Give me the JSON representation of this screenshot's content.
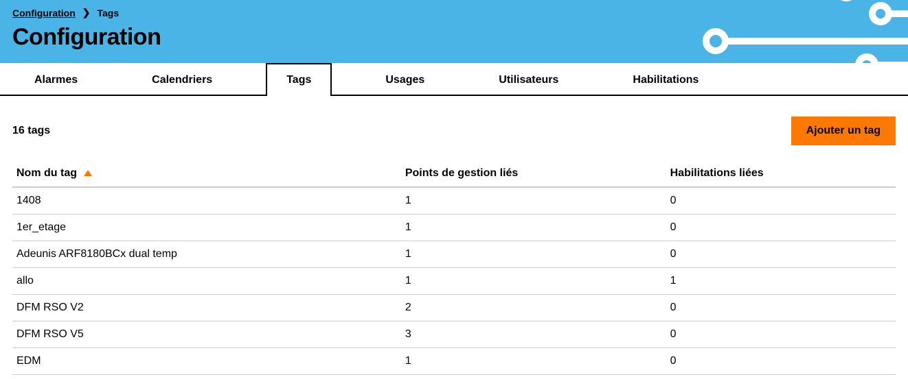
{
  "breadcrumb": {
    "root": "Configuration",
    "current": "Tags"
  },
  "page_title": "Configuration",
  "tabs": [
    {
      "label": "Alarmes",
      "active": false
    },
    {
      "label": "Calendriers",
      "active": false
    },
    {
      "label": "Tags",
      "active": true
    },
    {
      "label": "Usages",
      "active": false
    },
    {
      "label": "Utilisateurs",
      "active": false
    },
    {
      "label": "Habilitations",
      "active": false
    }
  ],
  "count_label": "16 tags",
  "add_button_label": "Ajouter un tag",
  "table": {
    "columns": {
      "name": "Nom du tag",
      "points": "Points de gestion liés",
      "habilitations": "Habilitations liées"
    },
    "sort": {
      "column": "name",
      "direction": "asc"
    },
    "rows": [
      {
        "name": "1408",
        "points": "1",
        "habilitations": "0"
      },
      {
        "name": "1er_etage",
        "points": "1",
        "habilitations": "0"
      },
      {
        "name": "Adeunis ARF8180BCx dual temp",
        "points": "1",
        "habilitations": "0"
      },
      {
        "name": "allo",
        "points": "1",
        "habilitations": "1"
      },
      {
        "name": "DFM RSO V2",
        "points": "2",
        "habilitations": "0"
      },
      {
        "name": "DFM RSO V5",
        "points": "3",
        "habilitations": "0"
      },
      {
        "name": "EDM",
        "points": "1",
        "habilitations": "0"
      }
    ]
  }
}
